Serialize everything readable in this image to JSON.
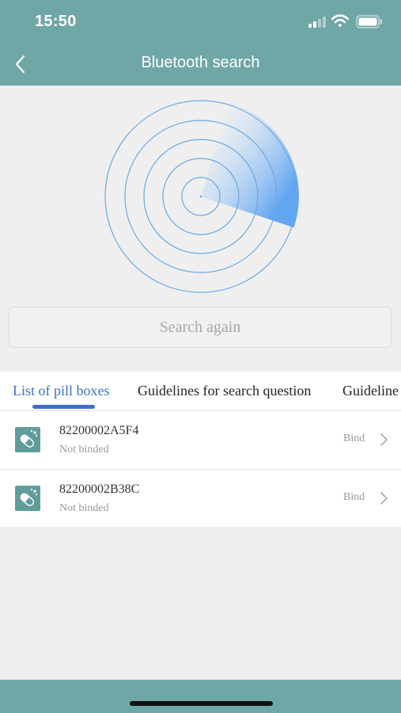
{
  "status": {
    "time": "15:50"
  },
  "nav": {
    "title": "Bluetooth search"
  },
  "search": {
    "button_label": "Search again"
  },
  "tabs": [
    {
      "label": "List of pill boxes",
      "active": true
    },
    {
      "label": "Guidelines for search question",
      "active": false
    },
    {
      "label": "Guideline",
      "active": false
    }
  ],
  "devices": [
    {
      "id": "82200002A5F4",
      "status": "Not binded",
      "action": "Bind"
    },
    {
      "id": "82200002B38C",
      "status": "Not binded",
      "action": "Bind"
    }
  ],
  "colors": {
    "header": "#6fa7a6",
    "accent_blue": "#3b6fd4",
    "radar_ring": "#6aa8e6",
    "icon_bg": "#5f9d9b"
  }
}
